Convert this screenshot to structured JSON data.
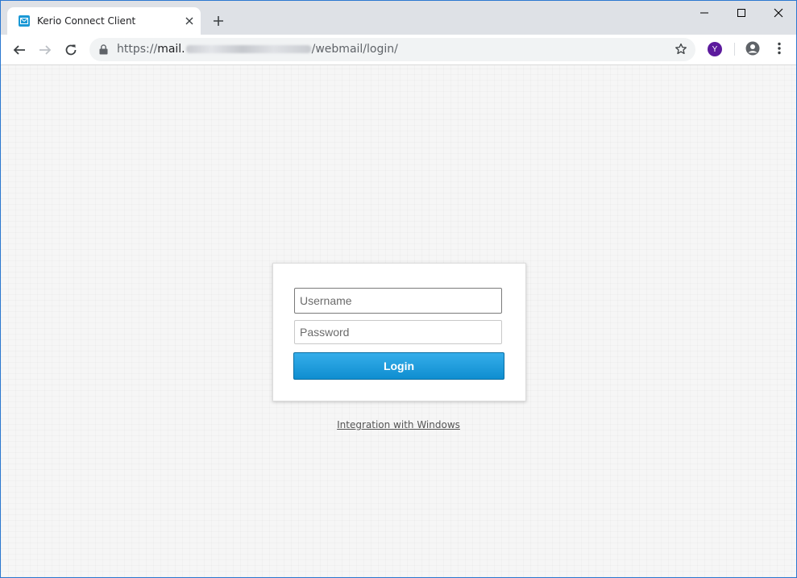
{
  "browser": {
    "tab": {
      "title": "Kerio Connect Client",
      "favicon": "envelope-icon"
    },
    "address": {
      "scheme": "https://",
      "host_prefix": "mail.",
      "path": "/webmail/login/"
    },
    "extension_label": "Y",
    "accent": "#1a98d5"
  },
  "login": {
    "username_placeholder": "Username",
    "password_placeholder": "Password",
    "login_label": "Login",
    "button_color": "#1a98d5"
  },
  "footer": {
    "integration_link": "Integration with Windows"
  }
}
